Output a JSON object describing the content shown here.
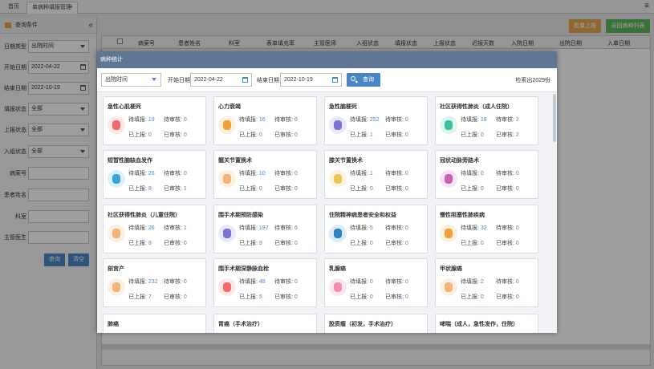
{
  "tabs": {
    "home": "首页",
    "active": "单病种填报管理",
    "close": "×"
  },
  "menu_icon": "≡",
  "sidebar": {
    "title": "查询条件",
    "collapse": "«",
    "date_type_label": "日期类型",
    "date_type_value": "出院时间",
    "start_label": "开始日期",
    "start_value": "2022-04-22",
    "end_label": "结束日期",
    "end_value": "2022-10-19",
    "fill_label": "填报状态",
    "fill_value": "全部",
    "report_label": "上报状态",
    "report_value": "全部",
    "group_label": "入组状态",
    "group_value": "全部",
    "case_label": "病案号",
    "patient_label": "患者姓名",
    "dept_label": "科室",
    "doctor_label": "主管医生",
    "query_btn": "查询",
    "clear_btn": "清空"
  },
  "toolbar": {
    "batch_report": "批量上报",
    "back_list": "返回病种列表"
  },
  "table": {
    "headers": [
      "病案号",
      "患者姓名",
      "科室",
      "表单填充率",
      "主管医师",
      "入组状态",
      "填报状态",
      "上报状态",
      "迟报天数",
      "入院日期",
      "出院日期",
      "入单日期"
    ]
  },
  "modal": {
    "title": "病种统计",
    "date_type": "出院时间",
    "start_label": "开始日期",
    "start_value": "2022-04-22",
    "end_label": "结束日期",
    "end_value": "2022-10-19",
    "query_btn": "查询",
    "count_text": "检索出2029份",
    "labels": {
      "to_fill": "待填报:",
      "to_review": "待审核:",
      "reported": "已上报:",
      "reviewed": "已审核:"
    },
    "cards": [
      {
        "title": "急性心肌梗死",
        "icon": "heart-icon",
        "color": "#f26b6b",
        "bg": "#fde7e7",
        "to_fill": "19",
        "to_review": "0",
        "reported": "0",
        "reviewed": "0"
      },
      {
        "title": "心力衰竭",
        "icon": "heart-failure-icon",
        "color": "#f0a23a",
        "bg": "#fdf0dc",
        "to_fill": "16",
        "to_review": "0",
        "reported": "0",
        "reviewed": "0"
      },
      {
        "title": "急性脑梗死",
        "icon": "brain-icon",
        "color": "#7b72d9",
        "bg": "#e9e7fa",
        "to_fill": "252",
        "to_review": "0",
        "reported": "1",
        "reviewed": "0"
      },
      {
        "title": "社区获得性肺炎（成人住院）",
        "icon": "lungs-icon",
        "color": "#3dbfa0",
        "bg": "#def6ef",
        "to_fill": "18",
        "to_review": "2",
        "reported": "0",
        "reviewed": "2"
      },
      {
        "title": "短暂性脑缺血发作",
        "icon": "brain-blue-icon",
        "color": "#3aa6d8",
        "bg": "#ddf1fa",
        "to_fill": "26",
        "to_review": "0",
        "reported": "8",
        "reviewed": "1"
      },
      {
        "title": "髋关节置换术",
        "icon": "hip-joint-icon",
        "color": "#f0b37a",
        "bg": "#fdf0e2",
        "to_fill": "10",
        "to_review": "0",
        "reported": "0",
        "reviewed": "0"
      },
      {
        "title": "膝关节置换术",
        "icon": "knee-joint-icon",
        "color": "#f0c25a",
        "bg": "#fdf4dd",
        "to_fill": "1",
        "to_review": "0",
        "reported": "0",
        "reviewed": "0"
      },
      {
        "title": "冠状动脉旁路术",
        "icon": "artery-icon",
        "color": "#c862b8",
        "bg": "#f8e4f4",
        "to_fill": "0",
        "to_review": "0",
        "reported": "0",
        "reviewed": "0"
      },
      {
        "title": "社区获得性肺炎（儿童住院）",
        "icon": "lungs-child-icon",
        "color": "#f0b37a",
        "bg": "#fdf0e2",
        "to_fill": "26",
        "to_review": "1",
        "reported": "8",
        "reviewed": "0"
      },
      {
        "title": "围手术期预防感染",
        "icon": "virus-icon",
        "color": "#7b72d9",
        "bg": "#e9e7fa",
        "to_fill": "197",
        "to_review": "6",
        "reported": "9",
        "reviewed": "0"
      },
      {
        "title": "住院精神病患者安全和权益",
        "icon": "head-icon",
        "color": "#2f7fc4",
        "bg": "#dcebf8",
        "to_fill": "5",
        "to_review": "0",
        "reported": "0",
        "reviewed": "0"
      },
      {
        "title": "慢性阻塞性肺疾病",
        "icon": "lungs-orange-icon",
        "color": "#f0a23a",
        "bg": "#fdf0dc",
        "to_fill": "32",
        "to_review": "0",
        "reported": "0",
        "reviewed": "0"
      },
      {
        "title": "剖宫产",
        "icon": "uterus-icon",
        "color": "#f0b37a",
        "bg": "#fdf0e2",
        "to_fill": "232",
        "to_review": "0",
        "reported": "7",
        "reviewed": "0"
      },
      {
        "title": "围手术期深静脉血栓",
        "icon": "blood-clot-icon",
        "color": "#f26b6b",
        "bg": "#fde7e7",
        "to_fill": "48",
        "to_review": "0",
        "reported": "5",
        "reviewed": "0"
      },
      {
        "title": "乳腺癌",
        "icon": "breast-icon",
        "color": "#f48fb1",
        "bg": "#fde7ef",
        "to_fill": "0",
        "to_review": "0",
        "reported": "0",
        "reviewed": "0"
      },
      {
        "title": "甲状腺癌",
        "icon": "thyroid-icon",
        "color": "#f0b37a",
        "bg": "#fdf0e2",
        "to_fill": "2",
        "to_review": "0",
        "reported": "0",
        "reviewed": "0"
      },
      {
        "title": "肺癌",
        "icon": "lung-cancer-icon",
        "color": "#3dbfa0",
        "bg": "#def6ef",
        "to_fill": "",
        "to_review": "",
        "reported": "",
        "reviewed": ""
      },
      {
        "title": "胃癌（手术治疗）",
        "icon": "stomach-icon",
        "color": "#f0a23a",
        "bg": "#fdf0dc",
        "to_fill": "",
        "to_review": "",
        "reported": "",
        "reviewed": ""
      },
      {
        "title": "胶质瘤（初发，手术治疗）",
        "icon": "glioma-icon",
        "color": "#7b72d9",
        "bg": "#e9e7fa",
        "to_fill": "",
        "to_review": "",
        "reported": "",
        "reviewed": ""
      },
      {
        "title": "哮喘（成人，急性发作，住院）",
        "icon": "asthma-icon",
        "color": "#3aa6d8",
        "bg": "#ddf1fa",
        "to_fill": "",
        "to_review": "",
        "reported": "",
        "reviewed": ""
      }
    ]
  }
}
